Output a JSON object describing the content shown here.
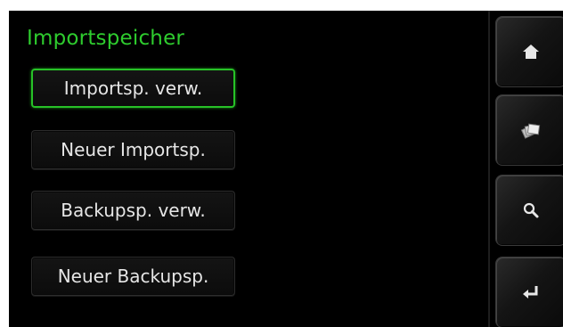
{
  "header": {
    "title": "Importspeicher"
  },
  "menu": {
    "items": [
      {
        "label": "Importsp. verw.",
        "selected": true
      },
      {
        "label": "Neuer Importsp.",
        "selected": false
      },
      {
        "label": "Backupsp. verw.",
        "selected": false
      },
      {
        "label": "Neuer Backupsp.",
        "selected": false
      }
    ]
  },
  "sidebar": {
    "buttons": [
      {
        "icon": "home-icon"
      },
      {
        "icon": "memory-cards-icon"
      },
      {
        "icon": "search-icon"
      },
      {
        "icon": "enter-return-icon"
      }
    ]
  },
  "colors": {
    "title": "#2ecc2e",
    "selection_border": "#27c227",
    "button_text": "#e6e6e6",
    "background": "#000000"
  }
}
